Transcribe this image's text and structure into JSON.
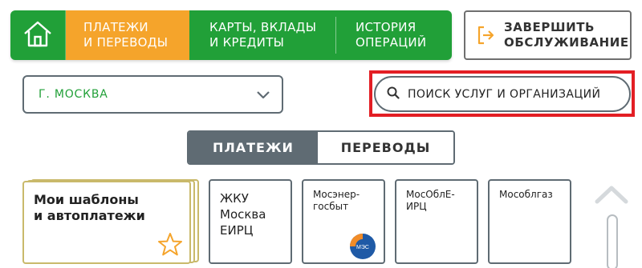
{
  "nav": {
    "home_icon": "home-icon",
    "payments_label": "ПЛАТЕЖИ\nИ ПЕРЕВОДЫ",
    "cards_label": "КАРТЫ, ВКЛАДЫ\nИ КРЕДИТЫ",
    "history_label": "ИСТОРИЯ\nОПЕРАЦИЙ"
  },
  "exit": {
    "icon": "exit-icon",
    "label": "ЗАВЕРШИТЬ\nОБСЛУЖИВАНИЕ"
  },
  "city": {
    "value": "Г. МОСКВА",
    "icon": "chevron-down-icon"
  },
  "search": {
    "placeholder": "ПОИСК УСЛУГ И ОРГАНИЗАЦИЙ",
    "icon": "search-icon",
    "highlight_color": "#e31e24"
  },
  "tabs": [
    {
      "label": "ПЛАТЕЖИ",
      "active": true
    },
    {
      "label": "ПЕРЕВОДЫ",
      "active": false
    }
  ],
  "cards": {
    "templates": {
      "title": "Мои шаблоны\nи автоплатежи",
      "icon": "star-icon"
    },
    "zhku": {
      "title": "ЖКУ\nМосква\nЕИРЦ"
    },
    "mosenergo": {
      "title": "Мосэнер-\nгосбыт",
      "logo_text": "МЭС"
    },
    "mosobleirc": {
      "title": "МосОблЕ-\nИРЦ"
    },
    "mosoblgaz": {
      "title": "Мособлгаз"
    }
  },
  "colors": {
    "brand_green": "#21a038",
    "accent_orange": "#f5a42b",
    "slate": "#5f6b73"
  }
}
